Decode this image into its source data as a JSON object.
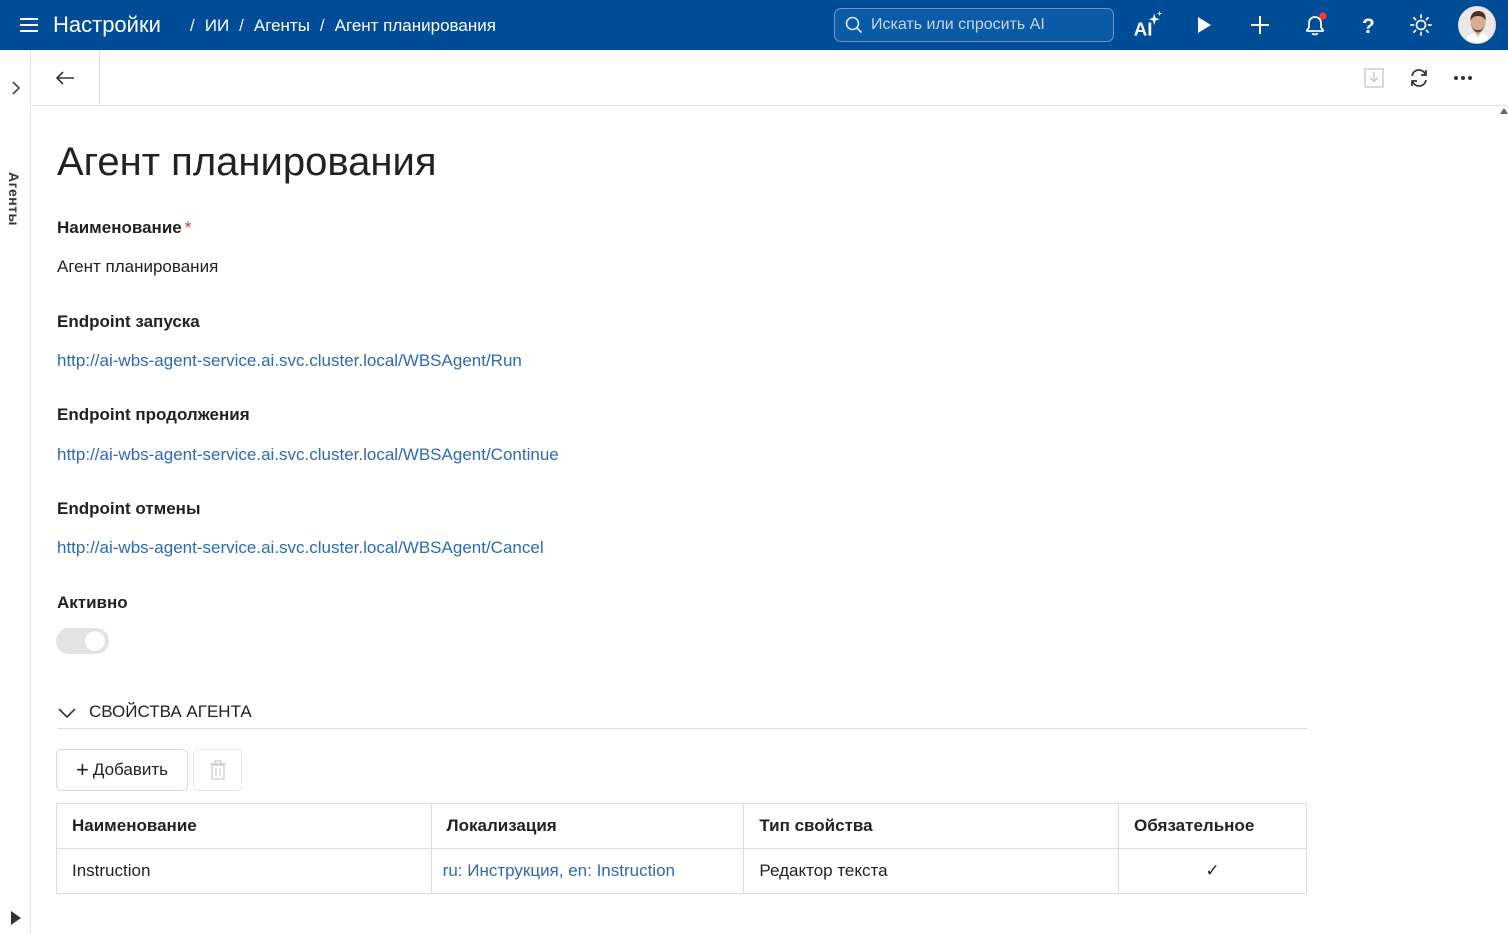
{
  "header": {
    "app_title": "Настройки",
    "breadcrumb": [
      "ИИ",
      "Агенты",
      "Агент планирования"
    ],
    "search_placeholder": "Искать или спросить AI",
    "icons": [
      "ai-sparkle-icon",
      "play-icon",
      "plus-icon",
      "bell-icon",
      "help-icon",
      "theme-sun-icon"
    ],
    "notification_dot_color": "#ff3b30"
  },
  "sidebar": {
    "label": "Агенты"
  },
  "toolbar": {
    "icons": [
      "back-arrow-icon",
      "download-icon",
      "refresh-icon",
      "more-icon"
    ]
  },
  "page": {
    "title": "Агент планирования",
    "fields": {
      "name_label": "Наименование",
      "name_required": "*",
      "name_value": "Агент планирования",
      "run_label": "Endpoint запуска",
      "run_value": "http://ai-wbs-agent-service.ai.svc.cluster.local/WBSAgent/Run",
      "continue_label": "Endpoint продолжения",
      "continue_value": "http://ai-wbs-agent-service.ai.svc.cluster.local/WBSAgent/Continue",
      "cancel_label": "Endpoint отмены",
      "cancel_value": "http://ai-wbs-agent-service.ai.svc.cluster.local/WBSAgent/Cancel",
      "active_label": "Активно"
    },
    "section": {
      "title": "СВОЙСТВА АГЕНТА",
      "add_label": "Добавить",
      "table": {
        "columns": [
          "Наименование",
          "Локализация",
          "Тип свойства",
          "Обязательное"
        ],
        "rows": [
          {
            "name": "Instruction",
            "localization": "ru: Инструкция, en: Instruction",
            "type": "Редактор текста",
            "required": "✓"
          }
        ]
      }
    }
  },
  "colors": {
    "header_bg": "#004c97",
    "link": "#2c6bb3",
    "required": "#d33"
  }
}
